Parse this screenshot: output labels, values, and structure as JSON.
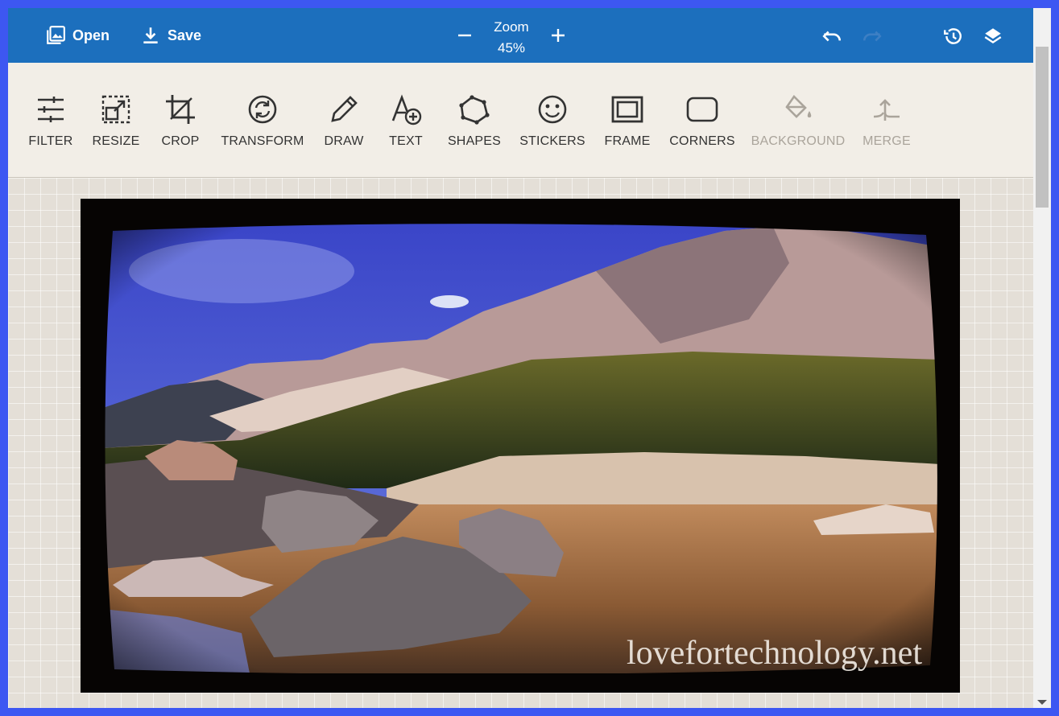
{
  "topbar": {
    "open_label": "Open",
    "save_label": "Save",
    "zoom_label": "Zoom",
    "zoom_value": "45%",
    "icons": [
      "image-icon",
      "download-icon",
      "minus-icon",
      "plus-icon",
      "undo-icon",
      "redo-icon",
      "history-icon",
      "layers-icon"
    ]
  },
  "toolbar": {
    "tools": [
      {
        "label": "FILTER",
        "icon": "sliders-icon",
        "enabled": true
      },
      {
        "label": "RESIZE",
        "icon": "resize-icon",
        "enabled": true
      },
      {
        "label": "CROP",
        "icon": "crop-icon",
        "enabled": true
      },
      {
        "label": "TRANSFORM",
        "icon": "transform-icon",
        "enabled": true
      },
      {
        "label": "DRAW",
        "icon": "pencil-icon",
        "enabled": true
      },
      {
        "label": "TEXT",
        "icon": "text-add-icon",
        "enabled": true
      },
      {
        "label": "SHAPES",
        "icon": "pentagon-icon",
        "enabled": true
      },
      {
        "label": "STICKERS",
        "icon": "smiley-icon",
        "enabled": true
      },
      {
        "label": "FRAME",
        "icon": "frame-icon",
        "enabled": true
      },
      {
        "label": "CORNERS",
        "icon": "rounded-rect-icon",
        "enabled": true
      },
      {
        "label": "BACKGROUND",
        "icon": "paint-bucket-icon",
        "enabled": false
      },
      {
        "label": "MERGE",
        "icon": "merge-icon",
        "enabled": false
      }
    ]
  },
  "canvas": {
    "watermark": "lovefortechnology.net"
  },
  "colors": {
    "page_border": "#3d57f2",
    "topbar": "#1c6fbd",
    "toolbar": "#f2eee7",
    "canvas": "#e4dfd7"
  }
}
